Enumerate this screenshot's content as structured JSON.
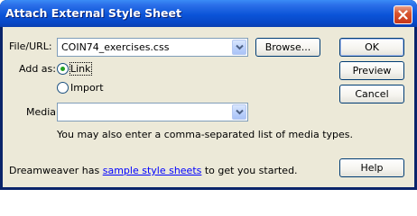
{
  "window": {
    "title": "Attach External Style Sheet"
  },
  "form": {
    "file_label": "File/URL:",
    "file_value": "COIN74_exercises.css",
    "browse_label": "Browse...",
    "add_as_label": "Add as:",
    "link_label": "Link",
    "import_label": "Import",
    "add_as_selected": "Link",
    "media_label": "Media:",
    "media_value": "",
    "media_hint": "You may also enter a comma-separated list of media types."
  },
  "buttons": {
    "ok": "OK",
    "preview": "Preview",
    "cancel": "Cancel",
    "help": "Help"
  },
  "footer": {
    "prefix": "Dreamweaver has ",
    "link": "sample style sheets",
    "suffix": " to get you started."
  },
  "icons": {
    "close": "close-icon",
    "dropdown": "chevron-down-icon"
  },
  "colors": {
    "titlebar": "#0b54d8",
    "close": "#d8552f",
    "dialog_bg": "#ece9d8",
    "link": "#0000ff",
    "radio_dot": "#21a121"
  }
}
